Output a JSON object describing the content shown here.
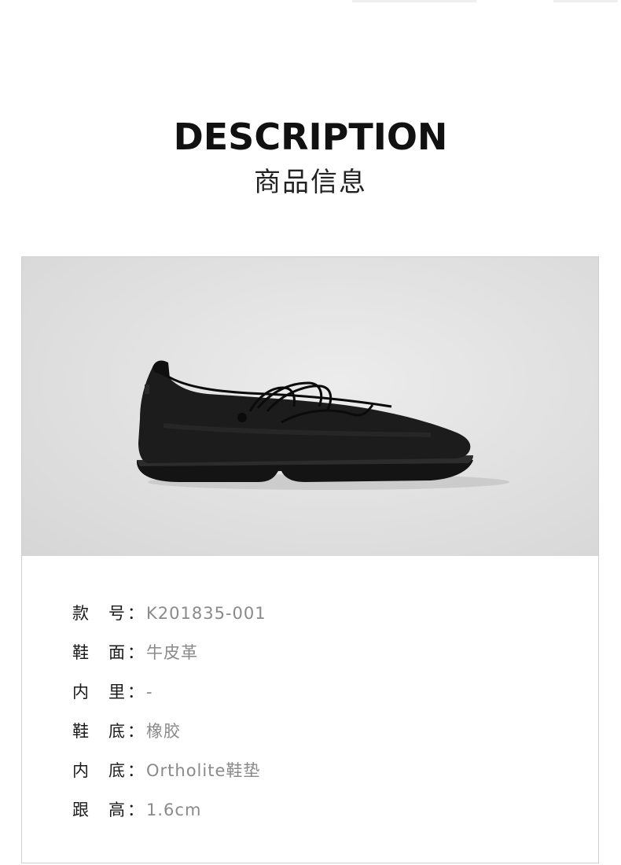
{
  "header": {
    "title": "DESCRIPTION",
    "subtitle": "商品信息"
  },
  "photo": {
    "subject": "black-leather-ballet-flat",
    "background_color": "#e3e3e3",
    "shoe_color": "#1c1c1c"
  },
  "specs": [
    {
      "label_first": "款",
      "label_second": "号",
      "colon": "：",
      "value": "K201835-001"
    },
    {
      "label_first": "鞋",
      "label_second": "面",
      "colon": "：",
      "value": "牛皮革"
    },
    {
      "label_first": "内",
      "label_second": "里",
      "colon": "：",
      "value": "-"
    },
    {
      "label_first": "鞋",
      "label_second": "底",
      "colon": "：",
      "value": "橡胶"
    },
    {
      "label_first": "内",
      "label_second": "底",
      "colon": "：",
      "value": "Ortholite鞋垫"
    },
    {
      "label_first": "跟",
      "label_second": "高",
      "colon": "：",
      "value": "1.6cm"
    }
  ]
}
